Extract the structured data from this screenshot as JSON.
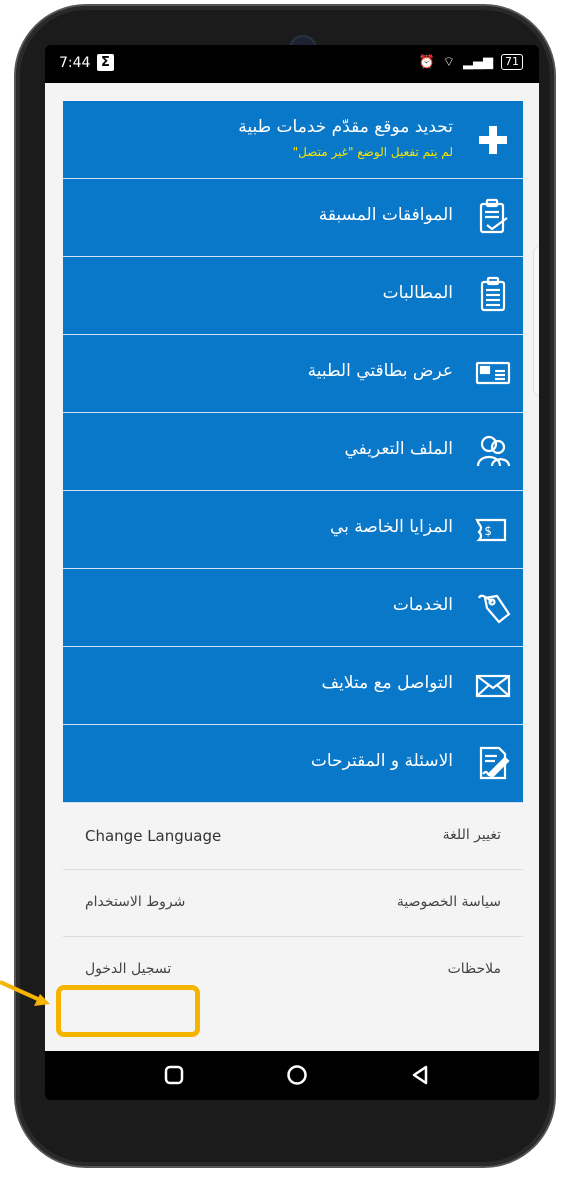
{
  "status_bar": {
    "time": "7:44",
    "notification_icon": "Σ",
    "battery": "71"
  },
  "menu": [
    {
      "label": "تحديد موقع مقدّم خدمات طبية",
      "sublabel": "لم يتم تفعيل الوضع \"غير متصل\"",
      "icon": "plus-icon"
    },
    {
      "label": "الموافقات المسبقة",
      "icon": "clipboard-check-icon"
    },
    {
      "label": "المطالبات",
      "icon": "clipboard-list-icon"
    },
    {
      "label": "عرض بطاقتي الطبية",
      "icon": "id-card-icon"
    },
    {
      "label": "الملف التعريفي",
      "icon": "people-icon"
    },
    {
      "label": "المزايا الخاصة بي",
      "icon": "money-icon"
    },
    {
      "label": "الخدمات",
      "icon": "tag-icon"
    },
    {
      "label": "التواصل مع متلايف",
      "icon": "envelope-icon"
    },
    {
      "label": "الاسئلة و المقترحات",
      "icon": "document-pen-icon"
    }
  ],
  "footer": {
    "change_language": "Change Language",
    "change_language_ar": "تغيير اللغة",
    "terms": "شروط الاستخدام",
    "privacy": "سياسة الخصوصية",
    "login": "تسجيل الدخول",
    "notes": "ملاحظات"
  },
  "colors": {
    "menu_bg": "#0a78c9",
    "sublabel": "#f5e400",
    "highlight": "#f5b400"
  }
}
